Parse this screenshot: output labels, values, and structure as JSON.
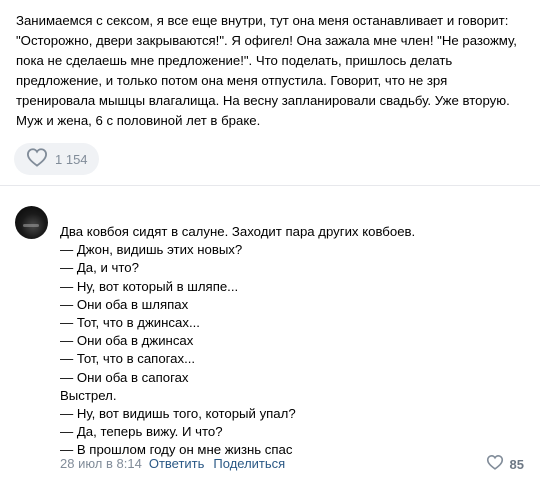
{
  "post": {
    "lines": [
      "Занимаемся с сексом, я все еще внутри, тут она меня останавливает и говорит:",
      "\"Осторожно, двери закрываются!\". Я офигел! Она зажала мне член! \"Не разожму,",
      "пока не сделаешь мне предложение!\". Что поделать, пришлось делать",
      "предложение, и только потом она меня отпустила. Говорит, что не зря",
      "тренировала мышцы влагалища. На весну запланировали свадьбу. Уже вторую.",
      "Муж и жена, 6 с половиной лет в браке."
    ],
    "like_count": "1 154",
    "like_icon": "heart-icon"
  },
  "comment": {
    "avatar_icon": "user-avatar",
    "lines": [
      "Два ковбоя сидят в салуне. Заходит пара других ковбоев.",
      "— Джон, видишь этих новых?",
      "— Да, и что?",
      "— Ну, вот который в шляпе...",
      "— Они оба в шляпах",
      "— Тот, что в джинсах...",
      "— Они оба в джинсах",
      "— Тот, что в сапогах...",
      "— Они оба в сапогах",
      "Выстрел.",
      "— Ну, вот видишь того, который упал?",
      "— Да, теперь вижу. И что?",
      "— В прошлом году он мне жизнь спас"
    ],
    "date": "28 июл в 8:14",
    "reply_label": "Ответить",
    "share_label": "Поделиться",
    "like_count": "85",
    "like_icon": "heart-icon"
  },
  "colors": {
    "link": "#2a5885",
    "muted": "#818c99",
    "pill_bg": "#f0f2f5",
    "divider": "#e7e8ec"
  }
}
